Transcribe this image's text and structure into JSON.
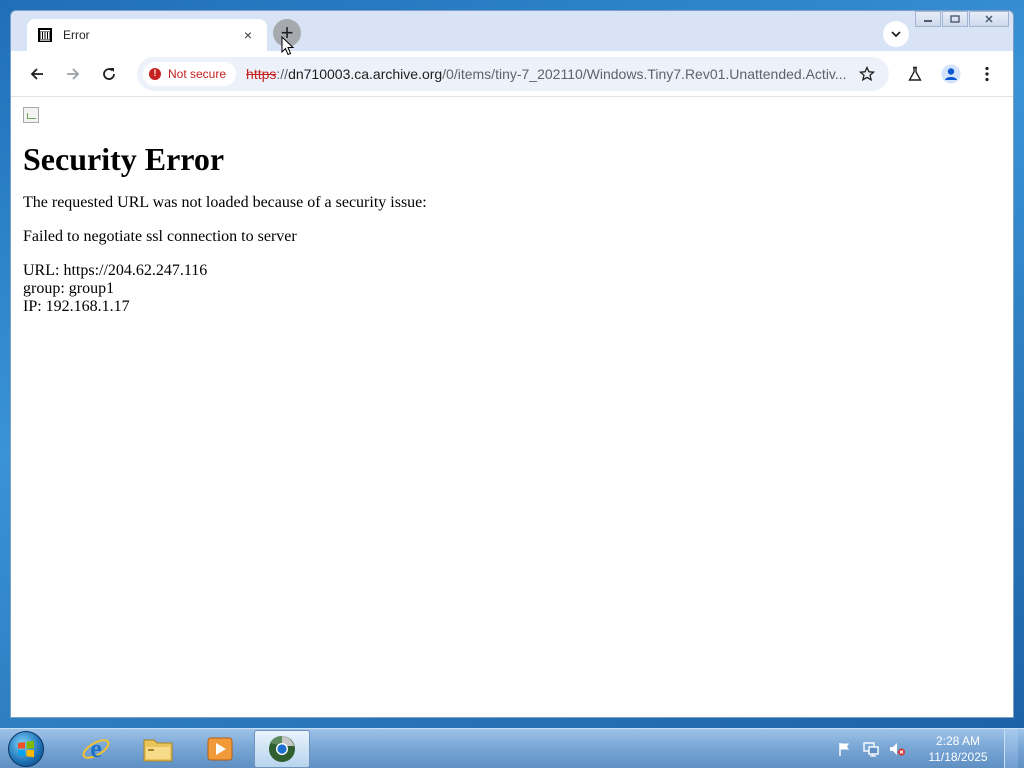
{
  "browser": {
    "tab": {
      "title": "Error",
      "close_glyph": "×",
      "favicon": "archive-icon"
    },
    "new_tab_glyph": "+",
    "tab_search_icon": "chevron-down-icon",
    "window_controls": {
      "minimize": "minimize-icon",
      "maximize": "maximize-icon",
      "close": "close-icon"
    },
    "toolbar": {
      "back_icon": "arrow-left-icon",
      "forward_icon": "arrow-right-icon",
      "reload_icon": "reload-icon",
      "security_label": "Not secure",
      "url_scheme": "https",
      "url_sep": "://",
      "url_host": "dn710003.ca.archive.org",
      "url_path": "/0/items/tiny-7_202110/Windows.Tiny7.Rev01.Unattended.Activ...",
      "bookmark_icon": "star-icon",
      "labs_icon": "flask-icon",
      "profile_icon": "person-icon",
      "menu_icon": "kebab-menu-icon"
    }
  },
  "page": {
    "heading": "Security Error",
    "message": "The requested URL was not loaded because of a security issue:",
    "reason": "Failed to negotiate ssl connection to server",
    "details": {
      "url_line": "URL: https://204.62.247.116",
      "group_line": "group: group1",
      "ip_line": "IP: 192.168.1.17"
    }
  },
  "taskbar": {
    "start_icon": "windows-start-icon",
    "apps": [
      {
        "name": "internet-explorer-icon"
      },
      {
        "name": "file-explorer-icon"
      },
      {
        "name": "media-player-icon"
      },
      {
        "name": "chrome-icon",
        "active": true
      }
    ],
    "tray": {
      "flag_icon": "action-center-flag-icon",
      "network_icon": "network-icon",
      "volume_icon": "volume-muted-icon"
    },
    "clock": {
      "time": "2:28 AM",
      "date": "11/18/2025"
    }
  },
  "colors": {
    "not_secure": "#c5221f",
    "omnibox_bg": "#edf2fa",
    "tabstrip_bg": "#d8e3f6",
    "desktop": "#2a7fc6"
  }
}
